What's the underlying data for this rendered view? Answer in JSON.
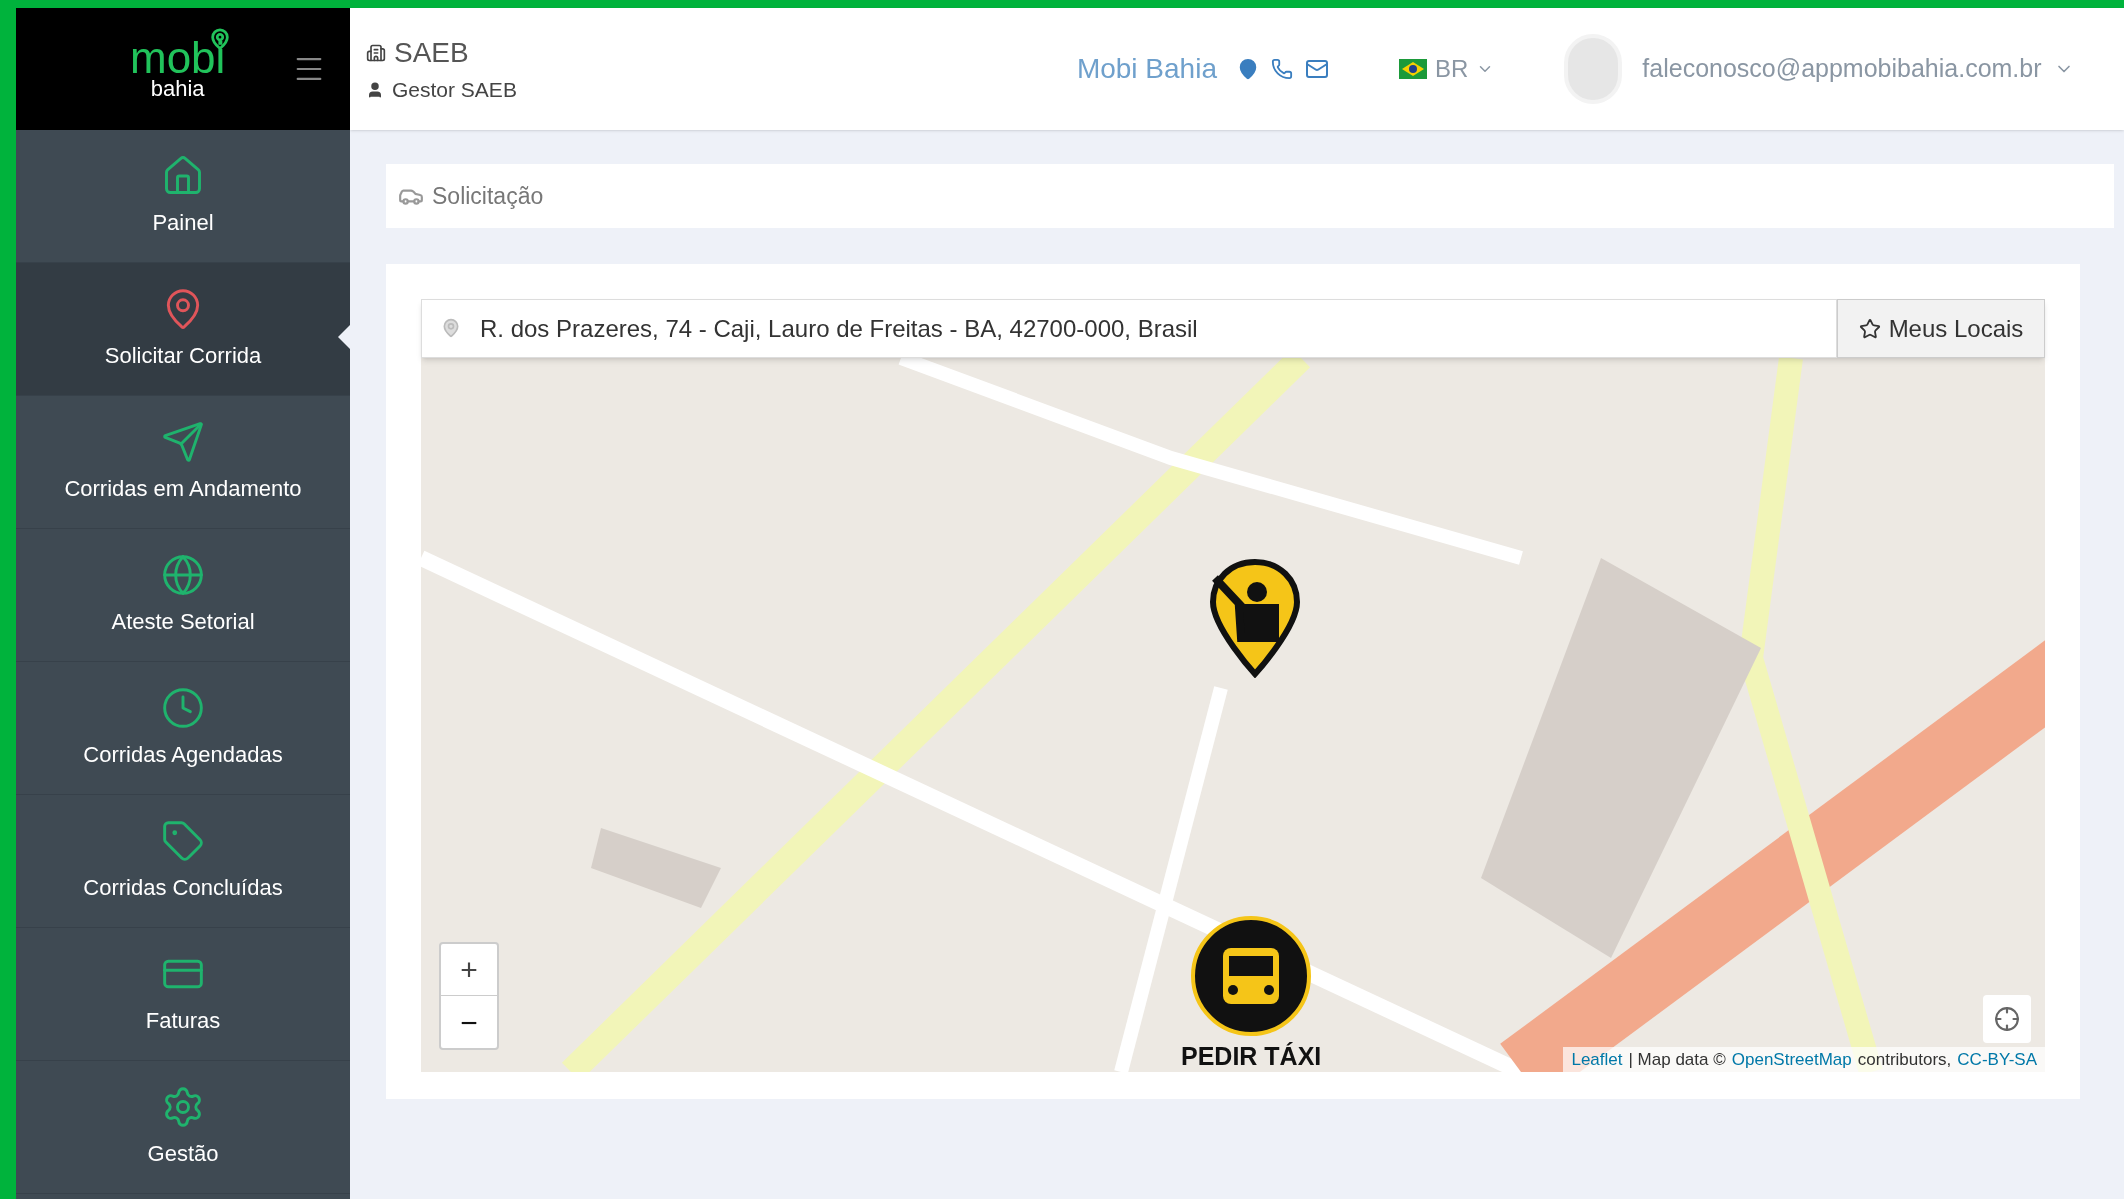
{
  "sidebar": {
    "logo": {
      "word": "mobi",
      "sub": "bahia"
    },
    "items": [
      {
        "label": "Painel",
        "selected": false
      },
      {
        "label": "Solicitar Corrida",
        "selected": true
      },
      {
        "label": "Corridas em Andamento",
        "selected": false
      },
      {
        "label": "Ateste Setorial",
        "selected": false
      },
      {
        "label": "Corridas Agendadas",
        "selected": false
      },
      {
        "label": "Corridas Concluídas",
        "selected": false
      },
      {
        "label": "Faturas",
        "selected": false
      },
      {
        "label": "Gestão",
        "selected": false
      }
    ]
  },
  "header": {
    "company": "SAEB",
    "role": "Gestor SAEB",
    "brand": "Mobi Bahia",
    "language": "BR",
    "user_email": "faleconosco@appmobibahia.com.br"
  },
  "breadcrumb": "Solicitação",
  "search": {
    "value": "R. dos Prazeres, 74 - Caji, Lauro de Freitas - BA, 42700-000, Brasil",
    "button": "Meus Locais"
  },
  "map": {
    "zoom_in": "+",
    "zoom_out": "−",
    "taxi_button": "PEDIR TÁXI",
    "attribution": [
      {
        "text": "Leaflet",
        "kind": "link"
      },
      {
        "text": "| Map data ©",
        "kind": "text"
      },
      {
        "text": "OpenStreetMap",
        "kind": "link"
      },
      {
        "text": "contributors,",
        "kind": "text"
      },
      {
        "text": "CC-BY-SA",
        "kind": "link"
      }
    ]
  }
}
